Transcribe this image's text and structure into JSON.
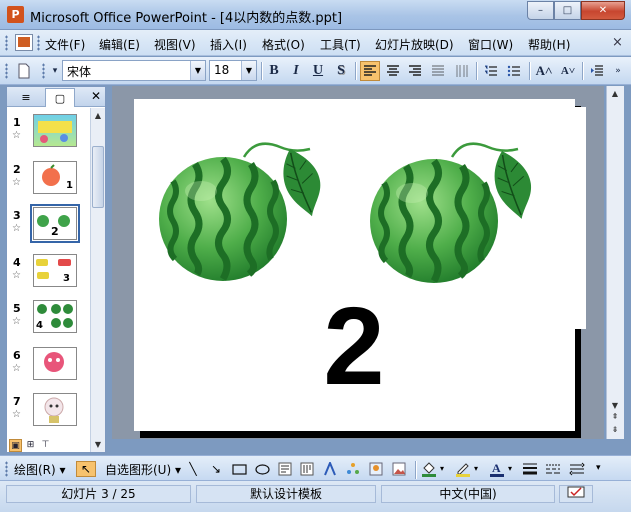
{
  "window": {
    "title": "Microsoft Office PowerPoint - [4以内数的点数.ppt]",
    "app_icon_letter": "P",
    "minimize_glyph": "–",
    "maximize_glyph": "□",
    "close_glyph": "✕"
  },
  "menubar": {
    "items": [
      "文件(F)",
      "编辑(E)",
      "视图(V)",
      "插入(I)",
      "格式(O)",
      "工具(T)",
      "幻灯片放映(D)",
      "窗口(W)",
      "帮助(H)"
    ],
    "doc_close": "×"
  },
  "toolbar": {
    "font_name": "宋体",
    "font_size": "18",
    "bold": "B",
    "italic": "I",
    "underline": "U",
    "shadow": "S",
    "grow_font": "A˄",
    "shrink_font": "A˅"
  },
  "left_panel": {
    "tab_outline_glyph": "≡",
    "tab_slides_glyph": "▢",
    "close_glyph": "✕",
    "thumbnails": [
      {
        "num": "1",
        "digit": ""
      },
      {
        "num": "2",
        "digit": "1"
      },
      {
        "num": "3",
        "digit": "2"
      },
      {
        "num": "4",
        "digit": "3"
      },
      {
        "num": "5",
        "digit": "4"
      },
      {
        "num": "6",
        "digit": ""
      },
      {
        "num": "7",
        "digit": ""
      }
    ],
    "selected_index": 2
  },
  "slide": {
    "number_text": "2"
  },
  "drawbar": {
    "draw_label": "绘图(R)",
    "autoshapes_label": "自选图形(U)"
  },
  "status": {
    "slide_info": "幻灯片 3 / 25",
    "design": "默认设计模板",
    "language": "中文(中国)"
  },
  "colors": {
    "watermelon_dark": "#1f7a2a",
    "watermelon_light": "#8fd27a",
    "accent_orange": "#f7c26d"
  }
}
